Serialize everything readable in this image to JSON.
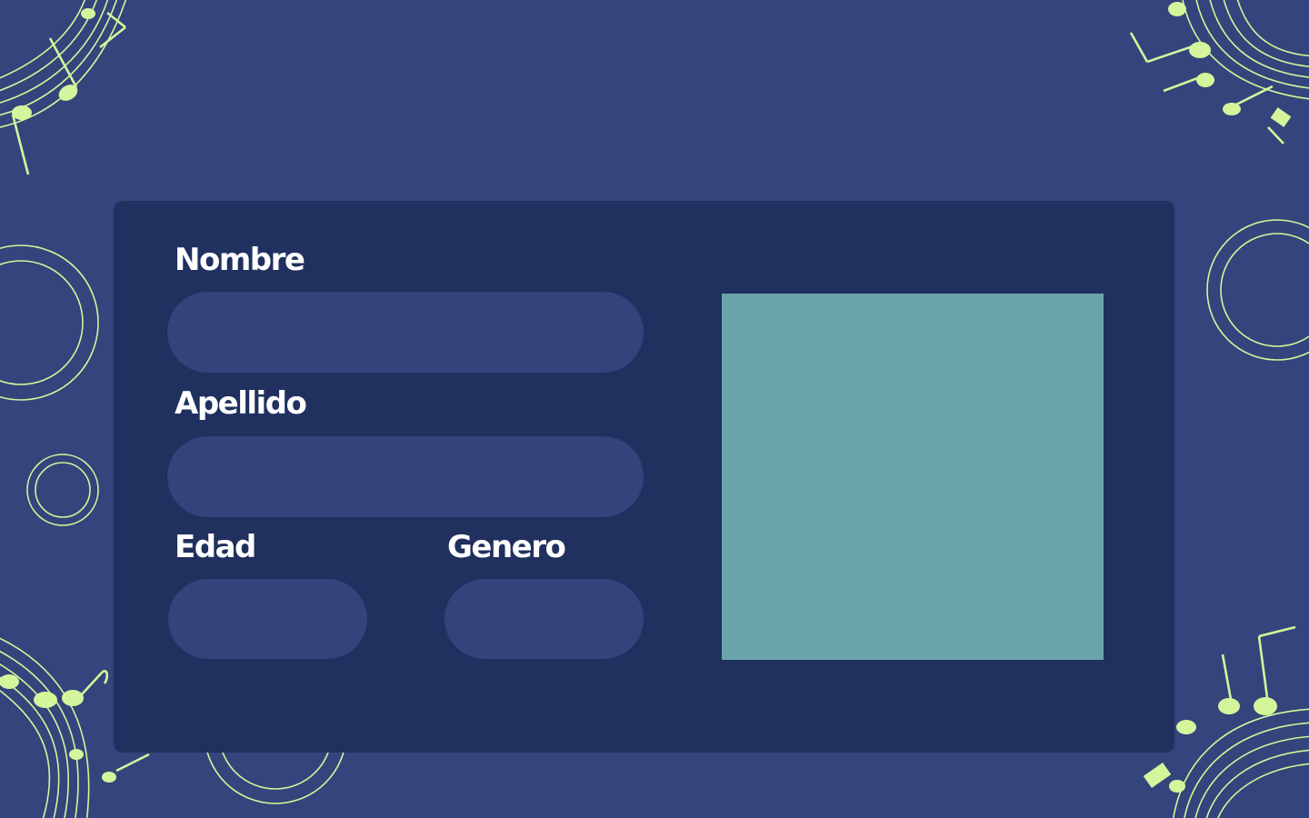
{
  "form": {
    "nombre": {
      "label": "Nombre",
      "value": ""
    },
    "apellido": {
      "label": "Apellido",
      "value": ""
    },
    "edad": {
      "label": "Edad",
      "value": ""
    },
    "genero": {
      "label": "Genero",
      "value": ""
    }
  },
  "photo": {
    "color": "#6ba4a9"
  },
  "theme": {
    "background": "#34447c",
    "card": "#20305f",
    "field": "#33437b",
    "accent": "#d4f59b",
    "text": "#ffffff"
  },
  "decorations": {
    "icons": [
      "music-staff-icon",
      "music-note-icon",
      "ring-icon"
    ]
  }
}
